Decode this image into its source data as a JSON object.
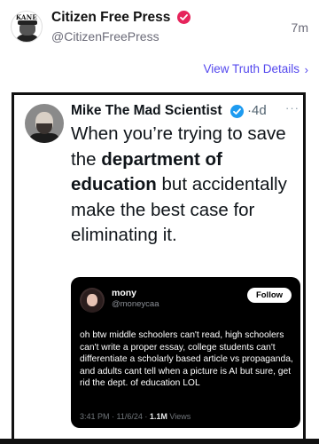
{
  "post": {
    "author_name": "Citizen Free Press",
    "author_handle": "@CitizenFreePress",
    "avatar_text": "KANE",
    "time_ago": "7m",
    "view_details_label": "View Truth Details",
    "view_details_chevron": "›"
  },
  "embedded_tweet": {
    "author_name": "Mike The Mad Scientist",
    "time": "4d",
    "time_separator": "·",
    "more_label": "···",
    "text_parts": {
      "part1": "When you’re trying to save the ",
      "bold": "department of education",
      "part2": " but accidentally make the best case for eliminating it."
    }
  },
  "quoted_tweet": {
    "author_name": "mony",
    "author_handle": "@moneycaa",
    "follow_label": "Follow",
    "text": "oh btw middle schoolers can't read, high schoolers can't write a proper essay, college students can't differentiate a scholarly based article vs propaganda, and adults cant tell when a picture is AI but sure, get rid the dept. of education LOL",
    "timestamp": "3:41 PM · 11/6/24 ·",
    "views_count": "1.1M",
    "views_label": "Views"
  },
  "colors": {
    "truth_verified": "#e6245b",
    "link_purple": "#5448ee",
    "twitter_verified": "#1d9bf0",
    "quote_card_bg": "#000000"
  },
  "icons": [
    "verified-badge-icon",
    "chevron-right-icon",
    "twitter-verified-icon",
    "more-options-icon"
  ]
}
